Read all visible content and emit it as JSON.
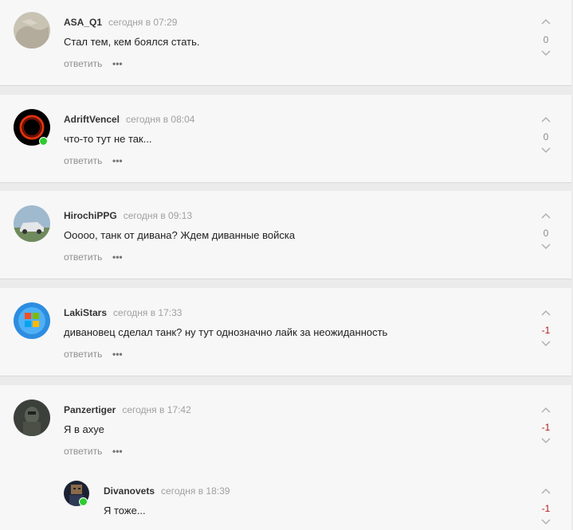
{
  "colors": {
    "score_neutral": "#8a8a8a",
    "score_negative": "#b51a1a",
    "online": "#2ecc2e"
  },
  "comments": [
    {
      "author": "ASA_Q1",
      "date": "сегодня в 07:29",
      "text": "Стал тем, кем боялся стать.",
      "reply": "ответить",
      "more": "•••",
      "score": "0",
      "online": false
    },
    {
      "author": "AdriftVencel",
      "date": "сегодня в 08:04",
      "text": "что-то тут не так...",
      "reply": "ответить",
      "more": "•••",
      "score": "0",
      "online": true
    },
    {
      "author": "HirochiPPG",
      "date": "сегодня в 09:13",
      "text": "Ооооо, танк от дивана? Ждем диванные войска",
      "reply": "ответить",
      "more": "•••",
      "score": "0",
      "online": false
    },
    {
      "author": "LakiStars",
      "date": "сегодня в 17:33",
      "text": "дивановец сделал танк? ну тут однозначно лайк за неожиданность",
      "reply": "ответить",
      "more": "•••",
      "score": "-1",
      "online": false
    },
    {
      "author": "Panzertiger",
      "date": "сегодня в 17:42",
      "text": "Я в ахуе",
      "reply": "ответить",
      "more": "•••",
      "score": "-1",
      "online": false
    },
    {
      "author": "Divanovets",
      "date": "сегодня в 18:39",
      "text": "Я тоже...",
      "reply": "",
      "more": "",
      "score": "-1",
      "online": true
    }
  ]
}
